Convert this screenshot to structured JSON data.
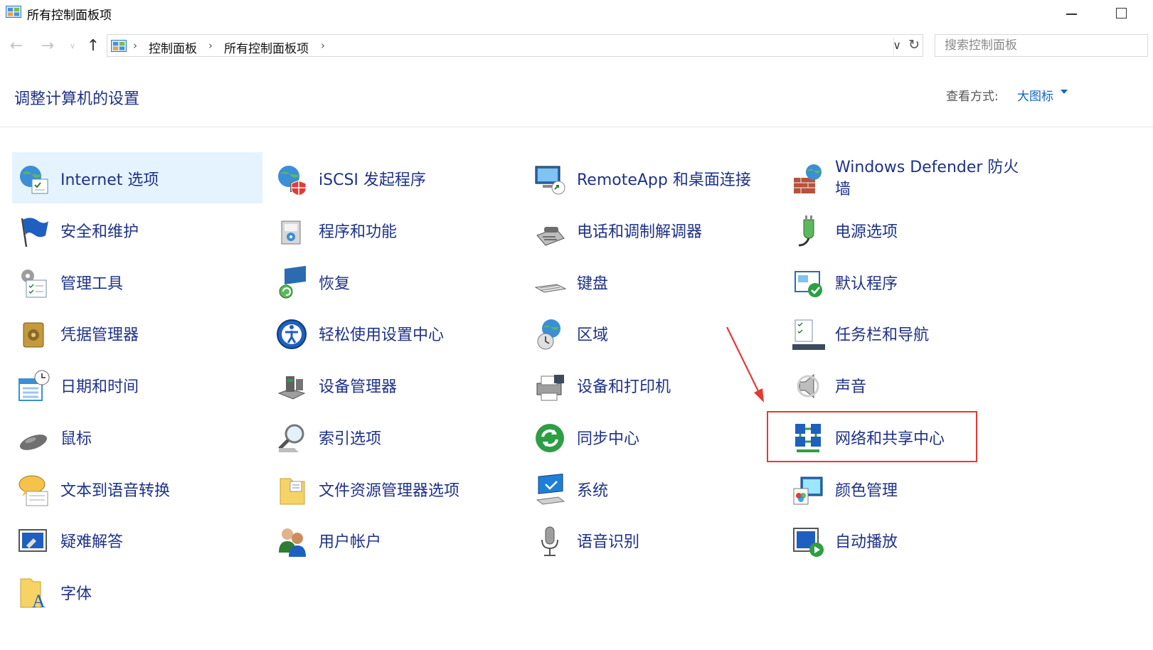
{
  "window": {
    "title": "所有控制面板项"
  },
  "address": {
    "crumbs": [
      "控制面板",
      "所有控制面板项"
    ],
    "search_placeholder": "搜索控制面板"
  },
  "header": {
    "heading": "调整计算机的设置",
    "view_by_label": "查看方式:",
    "view_by_value": "大图标"
  },
  "colors": {
    "link_text": "#1e3287",
    "accent": "#1565c0",
    "highlight": "#e53935",
    "selected_bg": "#e5f3ff"
  },
  "items": [
    {
      "label": "Internet 选项",
      "icon": "internet-options-icon"
    },
    {
      "label": "iSCSI 发起程序",
      "icon": "iscsi-icon"
    },
    {
      "label": "RemoteApp 和桌面连接",
      "icon": "remoteapp-icon"
    },
    {
      "label": "Windows Defender 防火墙",
      "icon": "firewall-icon"
    },
    {
      "label": "安全和维护",
      "icon": "flag-icon"
    },
    {
      "label": "程序和功能",
      "icon": "programs-icon"
    },
    {
      "label": "电话和调制解调器",
      "icon": "phone-icon"
    },
    {
      "label": "电源选项",
      "icon": "power-icon"
    },
    {
      "label": "管理工具",
      "icon": "admin-tools-icon"
    },
    {
      "label": "恢复",
      "icon": "recovery-icon"
    },
    {
      "label": "键盘",
      "icon": "keyboard-icon"
    },
    {
      "label": "默认程序",
      "icon": "default-programs-icon"
    },
    {
      "label": "凭据管理器",
      "icon": "credential-icon"
    },
    {
      "label": "轻松使用设置中心",
      "icon": "ease-of-access-icon"
    },
    {
      "label": "区域",
      "icon": "region-icon"
    },
    {
      "label": "任务栏和导航",
      "icon": "taskbar-icon"
    },
    {
      "label": "日期和时间",
      "icon": "datetime-icon"
    },
    {
      "label": "设备管理器",
      "icon": "device-manager-icon"
    },
    {
      "label": "设备和打印机",
      "icon": "printer-icon"
    },
    {
      "label": "声音",
      "icon": "sound-icon"
    },
    {
      "label": "鼠标",
      "icon": "mouse-icon"
    },
    {
      "label": "索引选项",
      "icon": "indexing-icon"
    },
    {
      "label": "同步中心",
      "icon": "sync-icon"
    },
    {
      "label": "网络和共享中心",
      "icon": "network-icon"
    },
    {
      "label": "文本到语音转换",
      "icon": "speech-bubble-icon"
    },
    {
      "label": "文件资源管理器选项",
      "icon": "folder-options-icon"
    },
    {
      "label": "系统",
      "icon": "system-icon"
    },
    {
      "label": "颜色管理",
      "icon": "color-management-icon"
    },
    {
      "label": "疑难解答",
      "icon": "troubleshoot-icon"
    },
    {
      "label": "用户帐户",
      "icon": "user-accounts-icon"
    },
    {
      "label": "语音识别",
      "icon": "microphone-icon"
    },
    {
      "label": "自动播放",
      "icon": "autoplay-icon"
    },
    {
      "label": "字体",
      "icon": "fonts-icon"
    }
  ]
}
